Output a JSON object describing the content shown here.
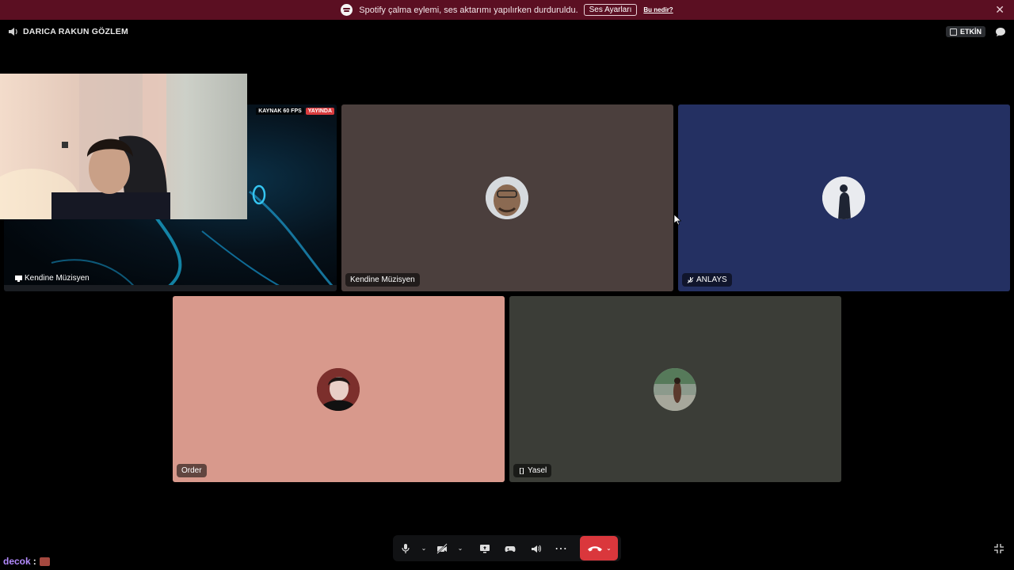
{
  "banner": {
    "message": "Spotify çalma eylemi, ses aktarımı yapılırken durduruldu.",
    "settings_button": "Ses Ayarları",
    "help_link": "Bu nedir?",
    "close": "✕",
    "bg": "#5b0f22"
  },
  "channel": {
    "name": "DARICA RAKUN GÖZLEM"
  },
  "top_right": {
    "status_label": "ETKİN"
  },
  "stream": {
    "badge_source": "KAYNAK 60 FPS",
    "badge_live": "YAYINDA",
    "label": "Kendine Müzisyen"
  },
  "tiles": [
    {
      "label": "Kendine Müzisyen",
      "bg": "#4b3f3d"
    },
    {
      "label": "ANLAYS",
      "bg": "#243062",
      "muted": true
    },
    {
      "label": "Order",
      "bg": "#d8998c"
    },
    {
      "label": "Yasel",
      "bg": "#3b3d37",
      "mobile": true
    }
  ],
  "controls": {
    "arrow": "⌄",
    "more": "⋯",
    "hangup_color": "#da373c"
  },
  "chat": {
    "user": "decok",
    "sep": ":"
  }
}
